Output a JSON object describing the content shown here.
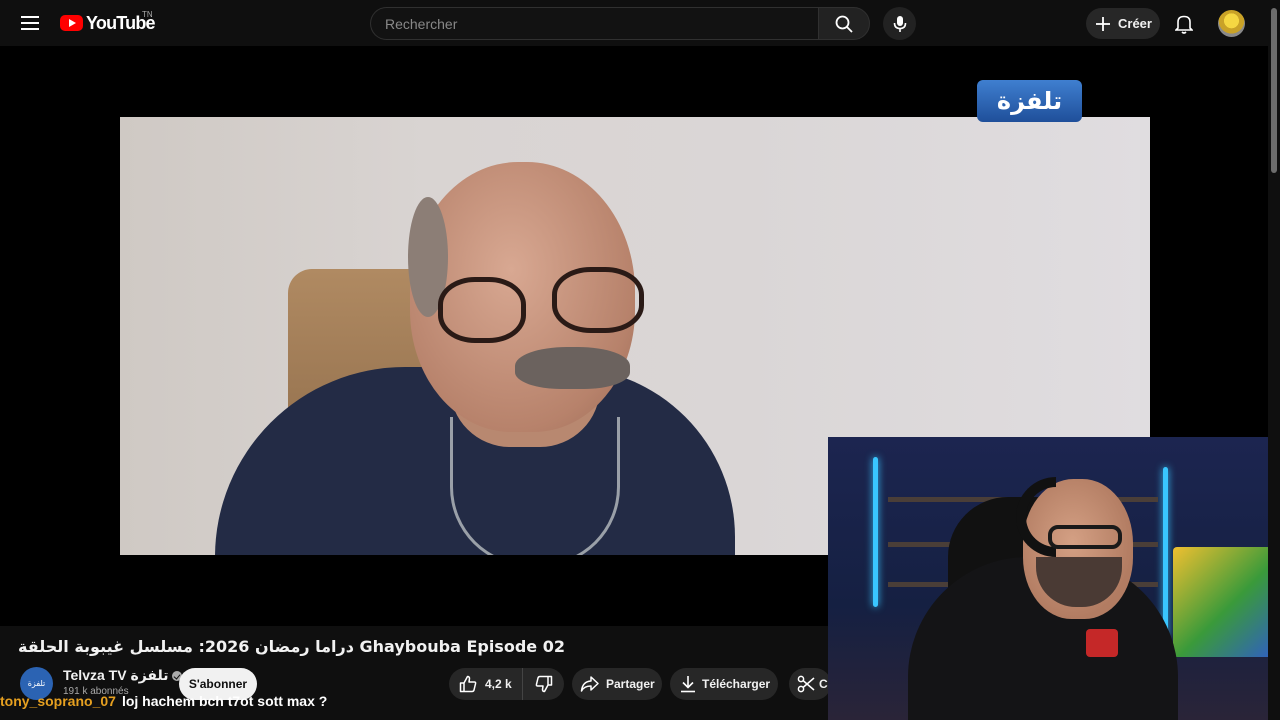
{
  "header": {
    "logo_text": "YouTube",
    "region": "TN",
    "search_placeholder": "Rechercher",
    "create_label": "Créer"
  },
  "video": {
    "channel_watermark": "تلفزة",
    "title": "دراما رمضان 2026: مسلسل غيبوبة الحلقة Ghaybouba Episode 02"
  },
  "channel": {
    "avatar_text": "تلفزة",
    "name": "Telvza TV تلفزة",
    "subscribers": "191 k abonnés",
    "subscribe_label": "S'abonner"
  },
  "actions": {
    "likes": "4,2 k",
    "share_label": "Partager",
    "download_label": "Télécharger",
    "clip_label": "C"
  },
  "chat": {
    "user": "tony_soprano_07",
    "message": "loj hachem bch t7ot sott max ?"
  },
  "colors": {
    "background": "#0f0f0f",
    "brand_red": "#ff0000",
    "chat_user": "#e6a020"
  }
}
